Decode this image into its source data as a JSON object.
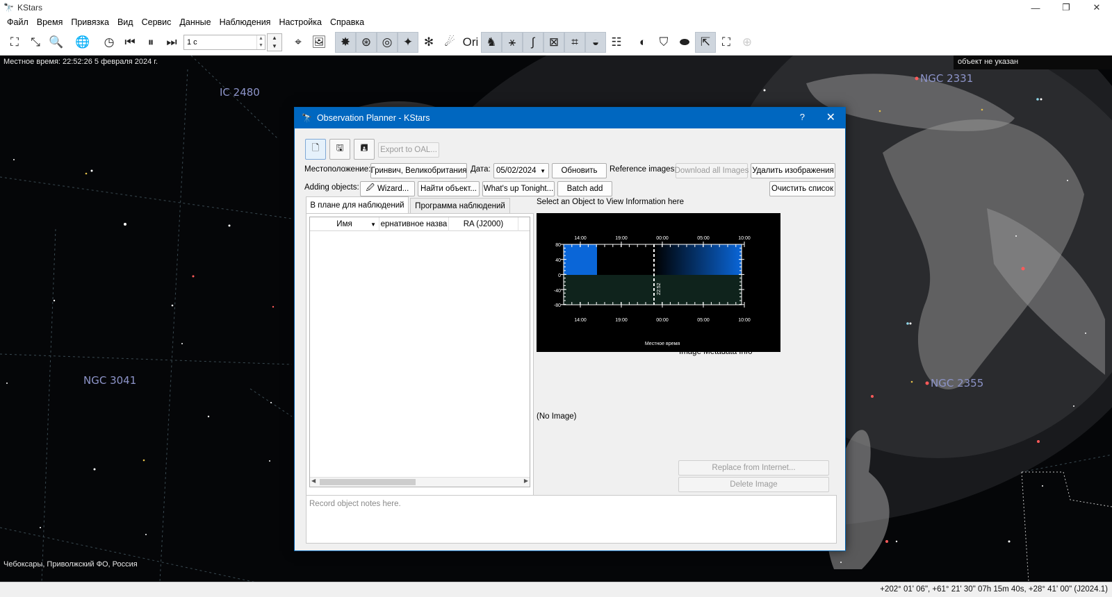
{
  "app": {
    "title": "KStars",
    "window_controls": [
      "—",
      "❐",
      "✕"
    ]
  },
  "menu": [
    "Файл",
    "Время",
    "Привязка",
    "Вид",
    "Сервис",
    "Данные",
    "Наблюдения",
    "Настройка",
    "Справка"
  ],
  "toolbar": {
    "time_step_value": "1 с"
  },
  "sky": {
    "local_time": "Местное время: 22:52:26   5 февраля 2024 г.",
    "focus": "объект не указан",
    "location": "Чебоксары, Приволжский ФО, Россия",
    "labels": {
      "ic2480": "IC 2480",
      "ngc2331": "NGC 2331",
      "ngc3041": "NGC 3041",
      "ngc2355": "NGC 2355"
    }
  },
  "statusbar": {
    "coords": "+202° 01' 06\", +61° 21' 30\"  07h 15m 40s, +28° 41' 00\" (J2024.1)"
  },
  "dialog": {
    "title": "Observation Planner - KStars",
    "help": "?",
    "close": "✕",
    "export_label": "Export to OAL...",
    "location_label": "Местоположение:",
    "location_value": "Гринвич, Великобритания",
    "date_label": "Дата:",
    "date_value": "05/02/2024",
    "refresh_label": "Обновить",
    "ref_images_label": "Reference images:",
    "download_all_label": "Download all Images",
    "delete_images_label": "Удалить изображения",
    "adding_objects_label": "Adding objects:",
    "wizard_label": "Wizard...",
    "find_object_label": "Найти объект...",
    "whats_up_label": "What's up Tonight...",
    "batch_add_label": "Batch add",
    "clear_list_label": "Очистить список",
    "tabs": [
      "В плане для наблюдений",
      "Программа наблюдений"
    ],
    "columns": [
      "Имя",
      "ернативное назва",
      "RA (J2000)"
    ],
    "select_hint": "Select an Object to View Information here",
    "metadata_label": "Image Metadata Info",
    "no_image": "(No Image)",
    "replace_label": "Replace from Internet...",
    "delete_image_label": "Delete Image",
    "notes_placeholder": "Record object notes here."
  },
  "altitude_chart": {
    "top_ticks": [
      "14:00",
      "19:00",
      "00:00",
      "05:00",
      "10:00"
    ],
    "bottom_ticks": [
      "14:00",
      "19:00",
      "00:00",
      "05:00",
      "10:00"
    ],
    "y_ticks": [
      "80",
      "40",
      "0",
      "-40",
      "-80"
    ],
    "now_label": "22:52",
    "xlabel": "Местное время",
    "colors": {
      "day": "#0a66d8",
      "ground": "#0f231c",
      "sky": "#000000"
    }
  }
}
